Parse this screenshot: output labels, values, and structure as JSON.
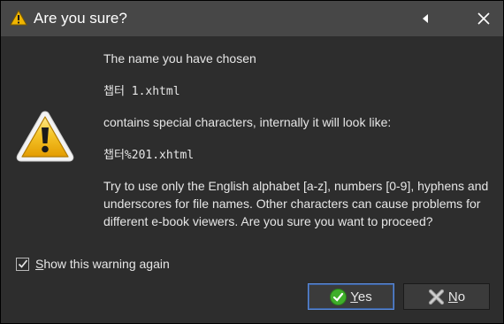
{
  "dialog": {
    "title": "Are you sure?",
    "line1": "The name you have chosen",
    "filename": "챕터 1.xhtml",
    "line2": "contains special characters, internally it will look like:",
    "encoded_filename": "챕터%201.xhtml",
    "warning_text": "Try to use only the English alphabet [a-z], numbers [0-9], hyphens and underscores for file names. Other characters can cause problems for different e-book viewers. Are you sure you want to proceed?"
  },
  "checkbox": {
    "checked": true,
    "label_mnemonic": "S",
    "label_rest": "how this warning again"
  },
  "buttons": {
    "yes_mnemonic": "Y",
    "yes_rest": "es",
    "no_mnemonic": "N",
    "no_rest": "o"
  },
  "icons": {
    "title": "warning-icon",
    "main": "warning-icon",
    "collapse": "collapse-arrow-icon",
    "close": "close-icon",
    "check": "checkmark-icon",
    "yes": "green-check-icon",
    "no": "red-x-icon"
  },
  "colors": {
    "titlebar": "#474747",
    "background": "#2d2d2d",
    "warning_yellow": "#f0b500",
    "yes_green": "#3fae2a",
    "no_gray": "#8a8a8a",
    "focus_border": "#5b8ad8"
  }
}
